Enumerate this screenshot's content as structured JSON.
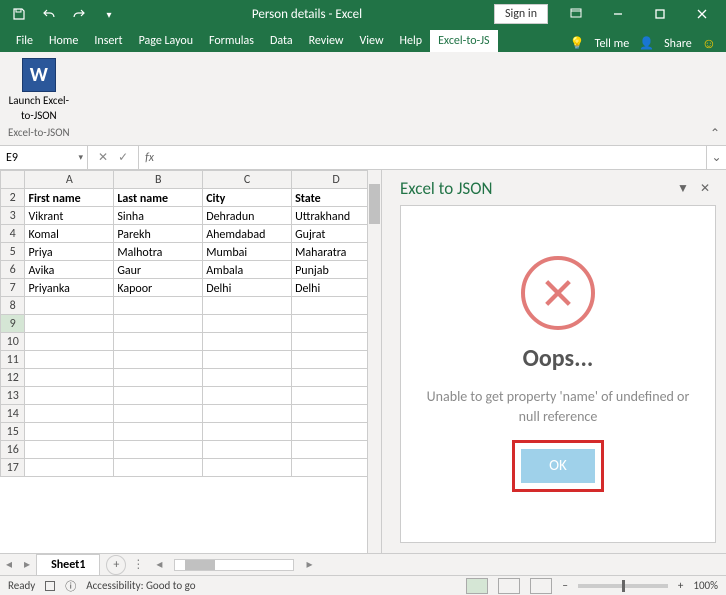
{
  "title": "Person details - Excel",
  "signin": "Sign in",
  "tabs": [
    "File",
    "Home",
    "Insert",
    "Page Layou",
    "Formulas",
    "Data",
    "Review",
    "View",
    "Help",
    "Excel-to-JS"
  ],
  "active_tab": "Excel-to-JS",
  "tellme": "Tell me",
  "share": "Share",
  "ribbon": {
    "launch_line1": "Launch Excel-",
    "launch_line2": "to-JSON",
    "group": "Excel-to-JSON"
  },
  "namebox": "E9",
  "formula": "",
  "columns": [
    "A",
    "B",
    "C",
    "D"
  ],
  "row_start": 2,
  "selected_row": 9,
  "data": [
    [
      "First name",
      "Last name",
      "City",
      "State"
    ],
    [
      "Vikrant",
      "Sinha",
      "Dehradun",
      "Uttrakhand"
    ],
    [
      "Komal",
      "Parekh",
      "Ahemdabad",
      "Gujrat"
    ],
    [
      "Priya",
      "Malhotra",
      "Mumbai",
      "Maharatra"
    ],
    [
      "Avika",
      "Gaur",
      "Ambala",
      "Punjab"
    ],
    [
      "Priyanka",
      "Kapoor",
      "Delhi",
      "Delhi"
    ]
  ],
  "taskpane": {
    "title": "Excel to JSON",
    "oops": "Oops...",
    "message": "Unable to get property 'name' of undefined or null reference",
    "ok": "OK"
  },
  "sheet": "Sheet1",
  "status": {
    "ready": "Ready",
    "access": "Accessibility: Good to go",
    "zoom": "100%"
  }
}
